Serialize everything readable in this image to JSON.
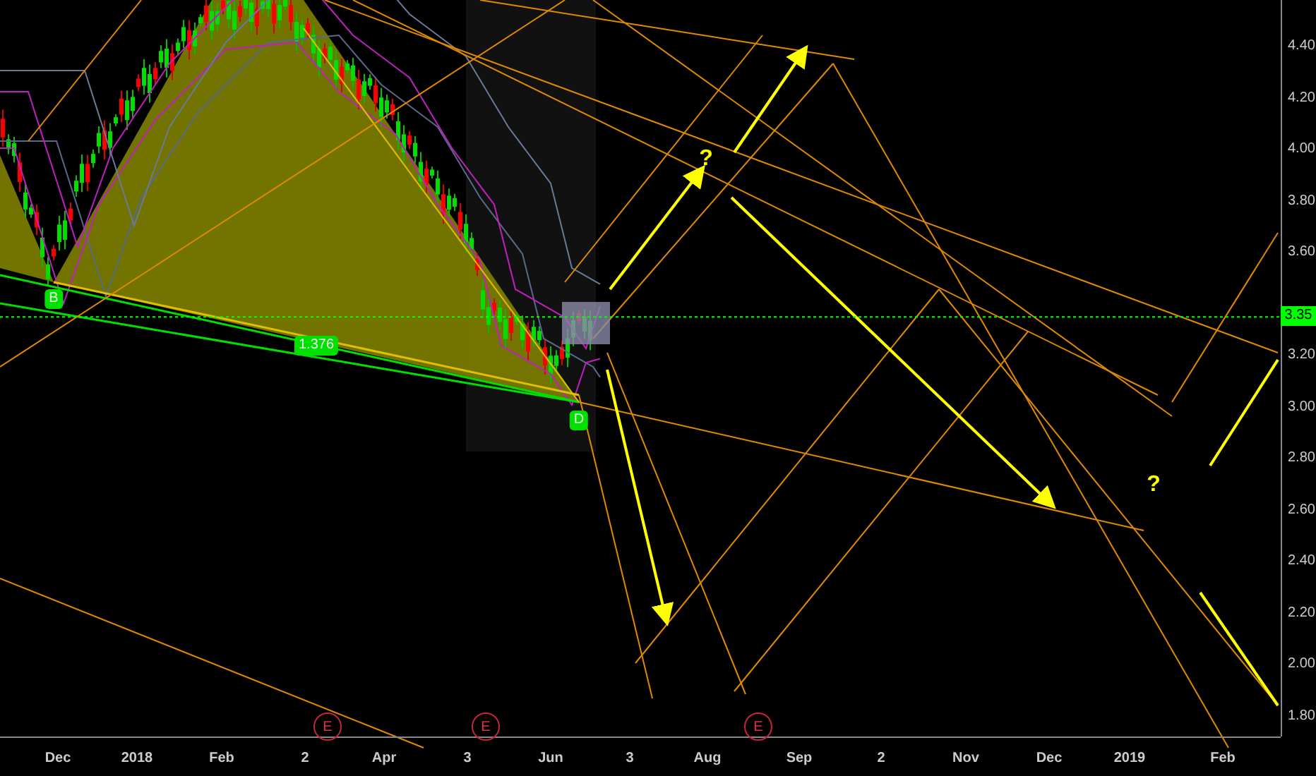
{
  "price_axis": {
    "labels": [
      "4.40",
      "4.20",
      "4.00",
      "3.80",
      "3.60",
      "3.20",
      "3.00",
      "2.80",
      "2.60",
      "2.40",
      "2.20",
      "2.00",
      "1.80"
    ],
    "current_price": "3.35"
  },
  "time_axis": {
    "labels": [
      "Dec",
      "2018",
      "Feb",
      "2",
      "Apr",
      "3",
      "Jun",
      "3",
      "Aug",
      "Sep",
      "2",
      "Nov",
      "Dec",
      "2019",
      "Feb"
    ]
  },
  "pattern_labels": [
    {
      "text": "B"
    },
    {
      "text": "1.376"
    },
    {
      "text": "D"
    }
  ],
  "annotations": [
    {
      "text": "?"
    },
    {
      "text": "?"
    }
  ],
  "events": [
    {
      "text": "E"
    },
    {
      "text": "E"
    },
    {
      "text": "E"
    }
  ]
}
